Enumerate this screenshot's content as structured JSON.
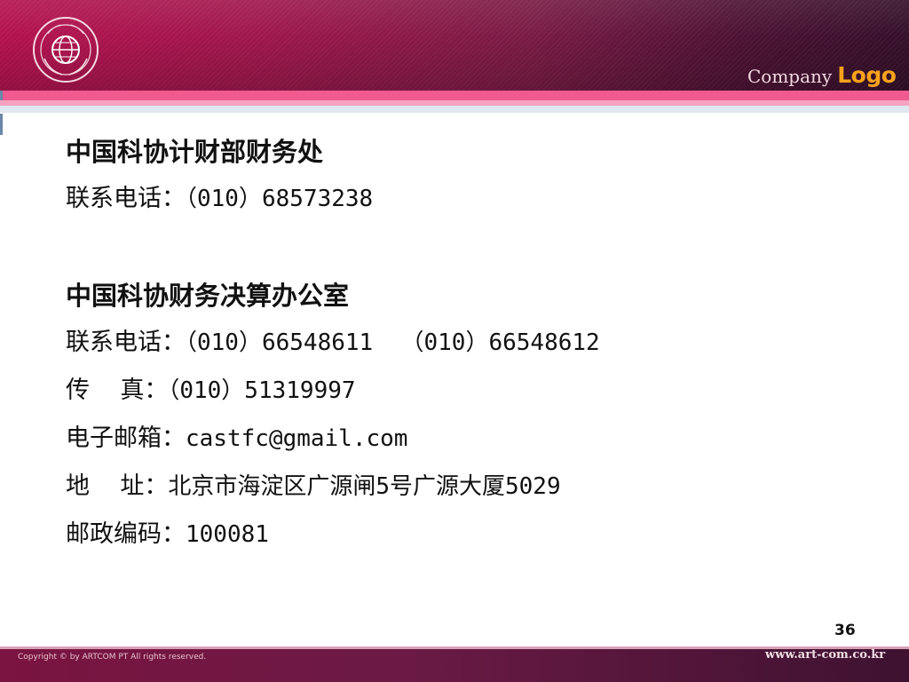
{
  "header": {
    "company_text": "Company",
    "logo_text": "Logo",
    "emblem": "association-emblem-icon"
  },
  "content": {
    "blocks": [
      {
        "title": "中国科协计财部财务处",
        "lines": [
          {
            "label": "联系电话：",
            "value": "（010）68573238"
          }
        ]
      },
      {
        "title": "中国科协财务决算办公室",
        "lines": [
          {
            "label": "联系电话：",
            "value": "（010）66548611  （010）66548612"
          },
          {
            "label": "传    真：",
            "value": "（010）51319997"
          },
          {
            "label": "电子邮箱：",
            "value": "castfc@gmail.com"
          },
          {
            "label": "地    址：",
            "value": "北京市海淀区广源闸5号广源大厦5029"
          },
          {
            "label": "邮政编码：",
            "value": "100081"
          }
        ]
      }
    ]
  },
  "footer": {
    "copyright": "Copyright © by ARTCOM PT  All rights reserved.",
    "website": "www.art-com.co.kr",
    "page_number": "36"
  },
  "colors": {
    "header_primary": "#b4124f",
    "header_dark": "#35102a",
    "accent_pink": "#f05a8e",
    "logo_orange": "#f8a21b"
  }
}
